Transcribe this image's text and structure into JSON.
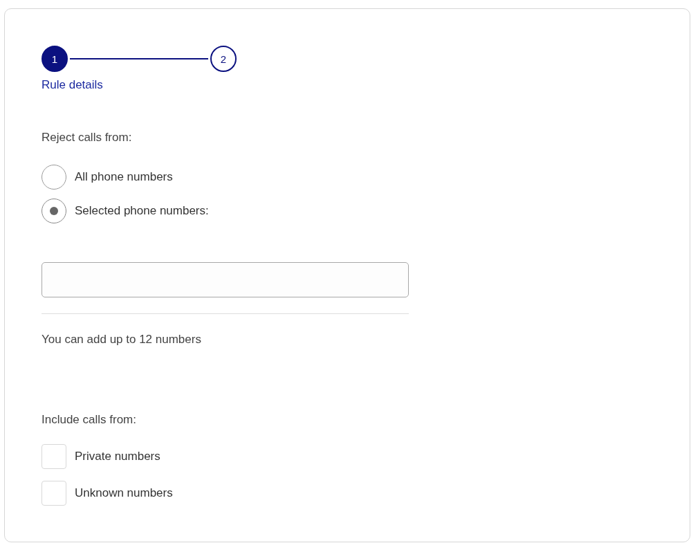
{
  "stepper": {
    "steps": [
      {
        "number": "1",
        "selected": true,
        "title": "Rule details"
      },
      {
        "number": "2",
        "selected": false
      }
    ]
  },
  "reject": {
    "label": "Reject calls from:",
    "options": [
      {
        "label": "All phone numbers",
        "selected": false
      },
      {
        "label": "Selected phone numbers:",
        "selected": true
      }
    ]
  },
  "numbers_field": {
    "hint": "You can add up to 12 numbers"
  },
  "include": {
    "label": "Include calls from:",
    "options": [
      {
        "label": "Private numbers",
        "checked": false
      },
      {
        "label": "Unknown numbers",
        "checked": false
      }
    ]
  }
}
